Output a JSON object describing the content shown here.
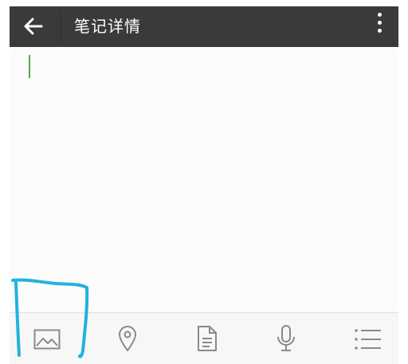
{
  "header": {
    "title": "笔记详情",
    "back_icon": "arrow-left-icon",
    "menu_icon": "more-vertical-icon",
    "background_color": "#3a3a3a",
    "text_color": "#ffffff"
  },
  "editor": {
    "content": "",
    "caret_color": "#5aa84a"
  },
  "toolbar": {
    "items": [
      {
        "name": "image",
        "icon": "image-icon"
      },
      {
        "name": "location",
        "icon": "location-pin-icon"
      },
      {
        "name": "document",
        "icon": "document-icon"
      },
      {
        "name": "voice",
        "icon": "microphone-icon"
      },
      {
        "name": "checklist",
        "icon": "checklist-icon"
      }
    ],
    "icon_color": "#8a8a8a"
  },
  "annotation": {
    "color": "#1fb3e0",
    "target": "image"
  }
}
